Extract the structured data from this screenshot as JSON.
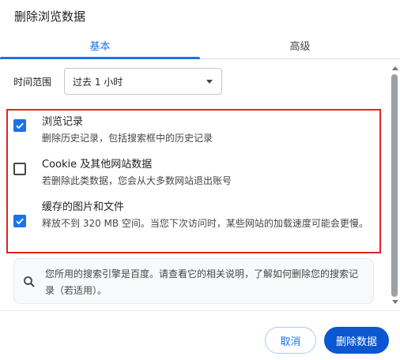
{
  "dialog": {
    "title": "删除浏览数据"
  },
  "tabs": [
    {
      "label": "基本",
      "active": true
    },
    {
      "label": "高级",
      "active": false
    }
  ],
  "time_range": {
    "label": "时间范围",
    "selected": "过去 1 小时"
  },
  "options": [
    {
      "title": "浏览记录",
      "description": "删除历史记录，包括搜索框中的历史记录",
      "checked": true
    },
    {
      "title": "Cookie 及其他网站数据",
      "description": "若删除此类数据，您会从大多数网站退出账号",
      "checked": false
    },
    {
      "title": "缓存的图片和文件",
      "description": "释放不到 320 MB 空间。当您下次访问时，某些网站的加载速度可能会更慢。",
      "checked": true
    }
  ],
  "info": {
    "text": "您所用的搜索引擎是百度。请查看它的相关说明，了解如何删除您的搜索记录（若适用）。"
  },
  "buttons": {
    "cancel": "取消",
    "delete": "删除数据"
  },
  "colors": {
    "accent": "#1a73e8",
    "primary_button": "#0b57d0",
    "highlight_border": "#e02424"
  }
}
